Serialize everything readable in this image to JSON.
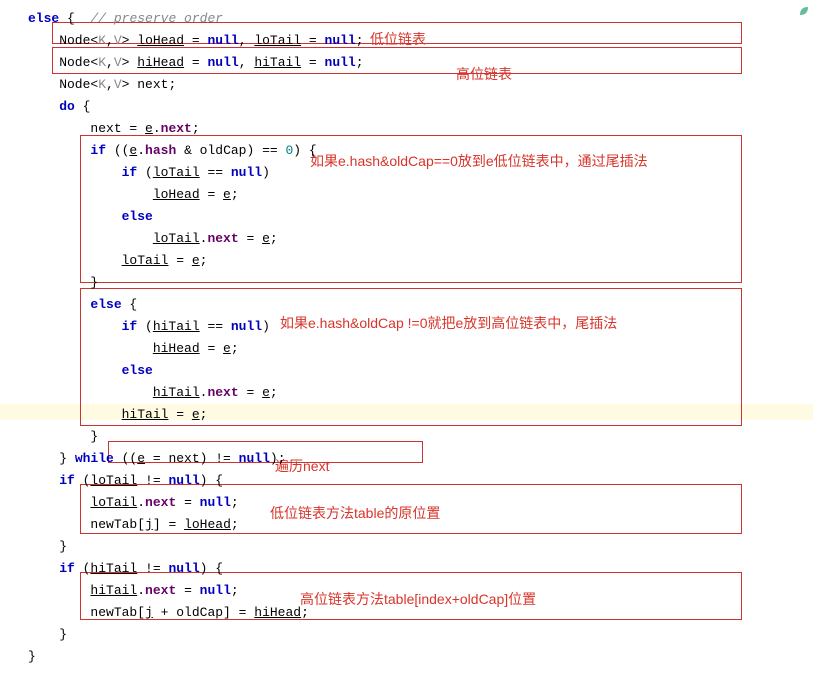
{
  "code": {
    "l1_else": "else",
    "l1_brace": " {  ",
    "l1_comment": "// preserve order",
    "l2a": "    Node<",
    "l2b": "K",
    "l2c": ",",
    "l2d": "V",
    "l2e": "> ",
    "l2_lohead": "loHead",
    "l2f": " = ",
    "l2_null1": "null",
    "l2g": ", ",
    "l2_lotail": "loTail",
    "l2h": " = ",
    "l2_null2": "null",
    "l2i": ";",
    "l3a": "    Node<",
    "l3b": "K",
    "l3c": ",",
    "l3d": "V",
    "l3e": "> ",
    "l3_hihead": "hiHead",
    "l3f": " = ",
    "l3_null1": "null",
    "l3g": ", ",
    "l3_hitail": "hiTail",
    "l3h": " = ",
    "l3_null2": "null",
    "l3i": ";",
    "l4a": "    Node<",
    "l4b": "K",
    "l4c": ",",
    "l4d": "V",
    "l4e": "> next;",
    "l5_do": "    do",
    "l5_brace": " {",
    "l6a": "        next = ",
    "l6_e": "e",
    "l6b": ".",
    "l6_next": "next",
    "l6c": ";",
    "l7_if": "        if",
    "l7a": " ((",
    "l7_e": "e",
    "l7b": ".",
    "l7_hash": "hash",
    "l7c": " & oldCap) == ",
    "l7_zero": "0",
    "l7d": ") {",
    "l8_if": "            if",
    "l8a": " (",
    "l8_lotail": "loTail",
    "l8b": " == ",
    "l8_null": "null",
    "l8c": ")",
    "l9a": "                ",
    "l9_lohead": "loHead",
    "l9b": " = ",
    "l9_e": "e",
    "l9c": ";",
    "l10_else": "            else",
    "l11a": "                ",
    "l11_lotail": "loTail",
    "l11b": ".",
    "l11_next": "next",
    "l11c": " = ",
    "l11_e": "e",
    "l11d": ";",
    "l12a": "            ",
    "l12_lotail": "loTail",
    "l12b": " = ",
    "l12_e": "e",
    "l12c": ";",
    "l13": "        }",
    "l14_else": "        else",
    "l14a": " {",
    "l15_if": "            if",
    "l15a": " (",
    "l15_hitail": "hiTail",
    "l15b": " == ",
    "l15_null": "null",
    "l15c": ")",
    "l16a": "                ",
    "l16_hihead": "hiHead",
    "l16b": " = ",
    "l16_e": "e",
    "l16c": ";",
    "l17_else": "            else",
    "l18a": "                ",
    "l18_hitail": "hiTail",
    "l18b": ".",
    "l18_next": "next",
    "l18c": " = ",
    "l18_e": "e",
    "l18d": ";",
    "l19a": "            ",
    "l19_hitail": "hiTail",
    "l19b": " = ",
    "l19_e": "e",
    "l19c": ";",
    "l20": "        }",
    "l21a": "    } ",
    "l21_while": "while",
    "l21b": " ((",
    "l21_e": "e",
    "l21c": " = next) != ",
    "l21_null": "null",
    "l21d": ");",
    "l22_if": "    if",
    "l22a": " (",
    "l22_lotail": "loTail",
    "l22b": " != ",
    "l22_null": "null",
    "l22c": ") {",
    "l23a": "        ",
    "l23_lotail": "loTail",
    "l23b": ".",
    "l23_next": "next",
    "l23c": " = ",
    "l23_null": "null",
    "l23d": ";",
    "l24a": "        newTab[",
    "l24_j": "j",
    "l24b": "] = ",
    "l24_lohead": "loHead",
    "l24c": ";",
    "l25": "    }",
    "l26_if": "    if",
    "l26a": " (",
    "l26_hitail": "hiTail",
    "l26b": " != ",
    "l26_null": "null",
    "l26c": ") {",
    "l27a": "        ",
    "l27_hitail": "hiTail",
    "l27b": ".",
    "l27_next": "next",
    "l27c": " = ",
    "l27_null": "null",
    "l27d": ";",
    "l28a": "        newTab[",
    "l28_j": "j",
    "l28b": " + oldCap] = ",
    "l28_hihead": "hiHead",
    "l28c": ";",
    "l29": "    }",
    "l30": "}"
  },
  "annotations": {
    "a1": "低位链表",
    "a2": "高位链表",
    "a3": "如果e.hash&oldCap==0放到e低位链表中，通过尾插法",
    "a4": "如果e.hash&oldCap !=0就把e放到高位链表中，尾插法",
    "a5": "遍历next",
    "a6": "低位链表方法table的原位置",
    "a7": "高位链表方法table[index+oldCap]位置"
  }
}
